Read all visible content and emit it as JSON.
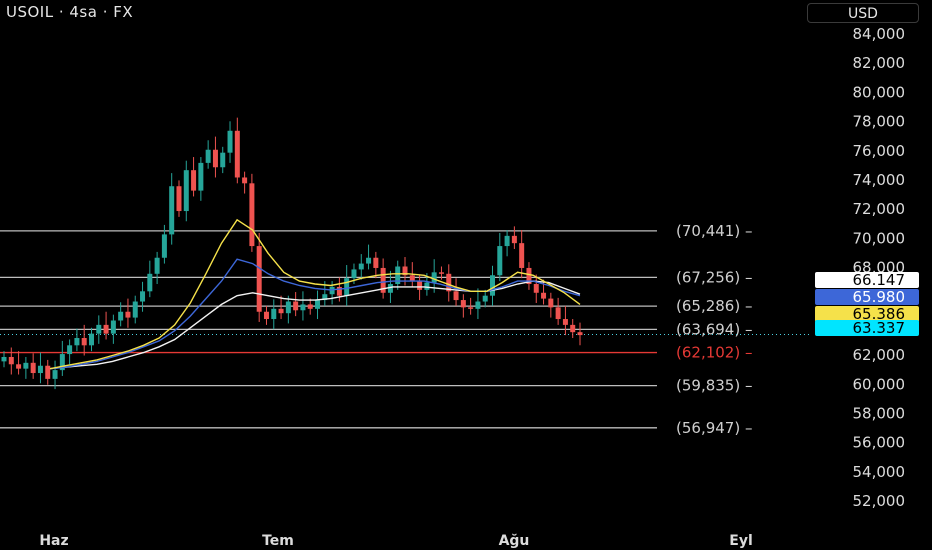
{
  "header": {
    "symbol_title": "USOIL · 4sa · FX",
    "currency_button": "USD"
  },
  "colors": {
    "background": "#000000",
    "candle_up": "#26a69a",
    "candle_down": "#ef5350",
    "ma_yellow": "#f5e14a",
    "ma_blue": "#3d67d8",
    "ma_white": "#f2f2f2",
    "level_line": "#bdbdbd",
    "support_red": "#e53935"
  },
  "chart_data": {
    "type": "candlestick",
    "y_axis": {
      "min": 51000,
      "max": 85000,
      "ticks": [
        "84,000",
        "82,000",
        "80,000",
        "78,000",
        "76,000",
        "74,000",
        "72,000",
        "70,000",
        "68,000",
        "66,000",
        "64,000",
        "62,000",
        "60,000",
        "58,000",
        "56,000",
        "54,000",
        "52,000"
      ]
    },
    "x_axis": {
      "labels": [
        "Haz",
        "Tem",
        "Ağu",
        "Eyl"
      ]
    },
    "levels": [
      {
        "label": "(70,441)",
        "value": 70441,
        "color": "#bdbdbd"
      },
      {
        "label": "(67,256)",
        "value": 67256,
        "color": "#bdbdbd"
      },
      {
        "label": "(65,286)",
        "value": 65286,
        "color": "#bdbdbd"
      },
      {
        "label": "(63,694)",
        "value": 63694,
        "color": "#bdbdbd"
      },
      {
        "label": "(62,102)",
        "value": 62102,
        "color": "#e53935"
      },
      {
        "label": "(59,835)",
        "value": 59835,
        "color": "#bdbdbd"
      },
      {
        "label": "(56,947)",
        "value": 56947,
        "color": "#bdbdbd"
      }
    ],
    "price_tags": [
      {
        "label": "66.147",
        "value": 66147,
        "bg": "#ffffff",
        "fg": "#000000"
      },
      {
        "label": "65.980",
        "value": 65980,
        "bg": "#3d67d8",
        "fg": "#ffffff"
      },
      {
        "label": "65.386",
        "value": 65386,
        "bg": "#f5e14a",
        "fg": "#000000"
      },
      {
        "label": "63.337",
        "value": 63337,
        "bg": "#00e5ff",
        "fg": "#000000"
      }
    ],
    "close_series": [
      61.8,
      61.3,
      61.0,
      61.4,
      60.7,
      61.2,
      60.3,
      60.9,
      62.0,
      62.6,
      63.1,
      62.6,
      63.4,
      64.0,
      63.4,
      64.3,
      64.9,
      64.5,
      65.6,
      66.3,
      67.5,
      68.6,
      70.2,
      73.5,
      71.8,
      74.6,
      73.2,
      75.1,
      76.0,
      74.8,
      75.8,
      77.3,
      74.1,
      73.7,
      69.4,
      64.9,
      64.4,
      65.1,
      64.8,
      65.6,
      65.0,
      65.4,
      65.1,
      65.7,
      66.1,
      66.6,
      66.0,
      67.2,
      67.8,
      68.2,
      68.6,
      67.9,
      66.2,
      66.8,
      68.0,
      67.4,
      67.0,
      66.4,
      66.9,
      67.6,
      67.5,
      66.3,
      65.7,
      65.2,
      65.1,
      65.6,
      66.0,
      67.4,
      69.4,
      70.1,
      69.6,
      67.9,
      66.8,
      66.2,
      65.8,
      65.2,
      64.4,
      64.0,
      63.5,
      63.3
    ],
    "ma_yellow": [
      61.0,
      61.2,
      61.4,
      61.6,
      61.9,
      62.2,
      62.6,
      63.1,
      64.0,
      65.5,
      67.5,
      69.6,
      71.2,
      70.5,
      68.9,
      67.6,
      67.0,
      66.8,
      66.7,
      66.9,
      67.2,
      67.4,
      67.5,
      67.5,
      67.4,
      67.0,
      66.6,
      66.3,
      66.3,
      66.9,
      67.6,
      67.4,
      66.8,
      66.2,
      65.4
    ],
    "ma_blue": [
      61.0,
      61.1,
      61.3,
      61.5,
      61.8,
      62.1,
      62.5,
      62.9,
      63.6,
      64.6,
      65.8,
      67.0,
      68.5,
      68.2,
      67.5,
      67.0,
      66.7,
      66.5,
      66.4,
      66.5,
      66.7,
      66.9,
      67.0,
      67.0,
      67.0,
      66.8,
      66.5,
      66.3,
      66.3,
      66.6,
      67.0,
      67.0,
      66.7,
      66.3,
      66.0
    ],
    "ma_white": [
      61.0,
      61.1,
      61.2,
      61.3,
      61.5,
      61.8,
      62.1,
      62.5,
      63.0,
      63.8,
      64.6,
      65.4,
      66.0,
      66.2,
      66.0,
      65.8,
      65.7,
      65.7,
      65.8,
      66.0,
      66.2,
      66.4,
      66.6,
      66.6,
      66.6,
      66.5,
      66.4,
      66.3,
      66.3,
      66.5,
      66.8,
      67.0,
      66.9,
      66.5,
      66.1
    ]
  }
}
